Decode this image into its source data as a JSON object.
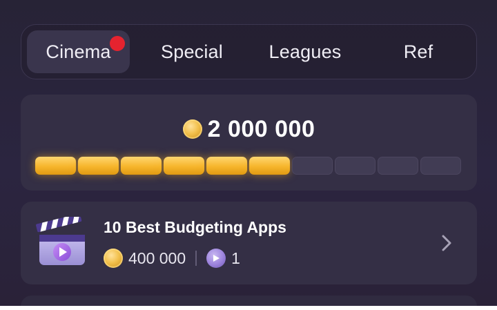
{
  "tabs": [
    {
      "label": "Cinema",
      "active": true,
      "has_notification": true
    },
    {
      "label": "Special",
      "active": false
    },
    {
      "label": "Leagues",
      "active": false
    },
    {
      "label": "Ref",
      "active": false
    }
  ],
  "reward": {
    "icon": "coin-icon",
    "amount": "2 000 000",
    "progress": {
      "filled": 6,
      "total": 10
    }
  },
  "tasks": [
    {
      "title": "10 Best Budgeting Apps",
      "icon": "movie-clapperboard-icon",
      "coins": "400 000",
      "tickets": "1"
    }
  ],
  "colors": {
    "background": "#272336",
    "card": "#342f45",
    "accent_gold": "#f6b52c",
    "notification_red": "#e5232f",
    "token_purple": "#9b82dc"
  }
}
